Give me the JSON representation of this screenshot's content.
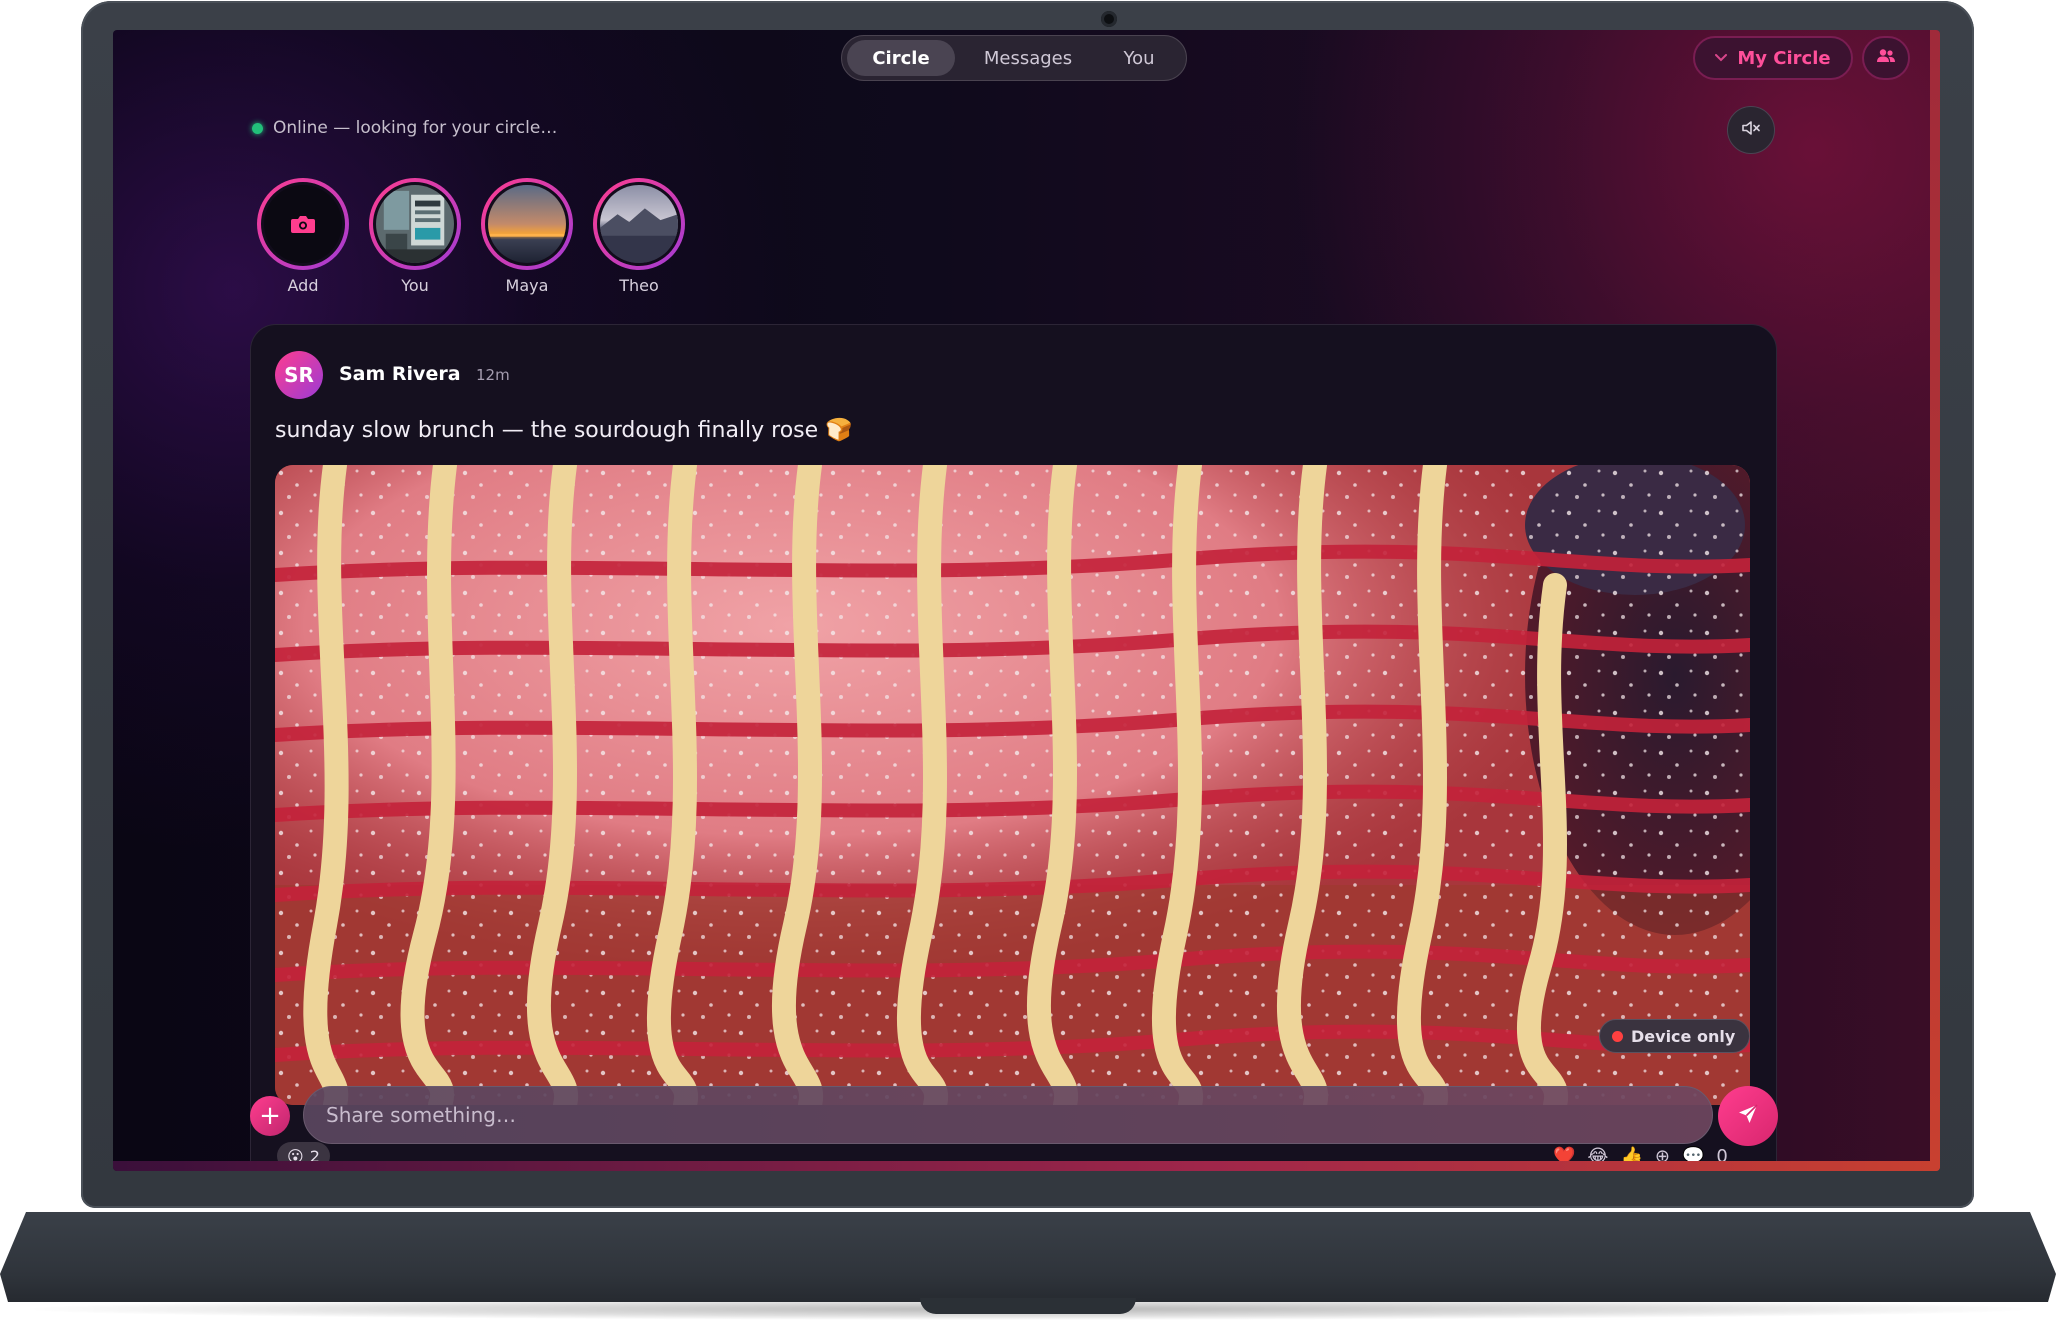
{
  "nav": {
    "tabs": [
      {
        "label": "Circle",
        "active": true
      },
      {
        "label": "Messages",
        "active": false
      },
      {
        "label": "You",
        "active": false
      }
    ]
  },
  "header": {
    "circle_button_label": "My Circle",
    "circle_icon": "chevron-down-icon",
    "people_icon": "people-icon",
    "mute_icon": "speaker-mute-icon"
  },
  "status": {
    "text": "Online — looking for your circle…",
    "color": "#22c07a"
  },
  "stories": [
    {
      "label": "Add",
      "icon": "camera-icon"
    },
    {
      "label": "You"
    },
    {
      "label": "Maya"
    },
    {
      "label": "Theo"
    }
  ],
  "post": {
    "author_initials": "SR",
    "author_name": "Sam Rivera",
    "time": "12m",
    "caption": "sunday slow brunch — the sourdough finally rose 🍞",
    "badge_label": "Device only"
  },
  "composer": {
    "placeholder": "Share something…"
  },
  "reactions": {
    "left_emoji": "😮",
    "left_count": "2",
    "right_icons": [
      "❤️",
      "😂",
      "👍",
      "⊕",
      "💬"
    ],
    "comment_count": "0"
  },
  "colors": {
    "accent": "#ff3d8e",
    "brand_dark": "#15101f"
  }
}
